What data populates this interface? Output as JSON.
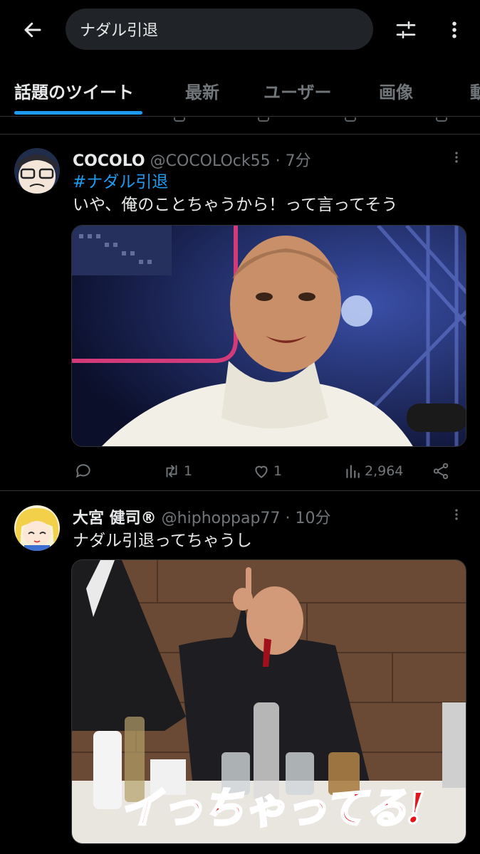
{
  "header": {
    "search_query": "ナダル引退"
  },
  "tabs": [
    {
      "label": "話題のツイート",
      "active": true
    },
    {
      "label": "最新"
    },
    {
      "label": "ユーザー"
    },
    {
      "label": "画像"
    },
    {
      "label": "動画"
    }
  ],
  "tweets": [
    {
      "name": "COCOLO",
      "handle": "@COCOLOck55",
      "time": "· 7分",
      "hashtag": "#ナダル引退",
      "text": "いや、俺のことちゃうから！って言ってそう",
      "replies": "",
      "retweets": "1",
      "likes": "1",
      "views": "2,964"
    },
    {
      "name": "大宮 健司®",
      "handle": "@hiphoppap77",
      "time": "· 10分",
      "text": "ナダル引退ってちゃうし",
      "image_caption": "イっちゃってる!"
    }
  ],
  "colors": {
    "accent": "#1d9bf0",
    "background": "#000000",
    "secondary_text": "#71767b"
  }
}
